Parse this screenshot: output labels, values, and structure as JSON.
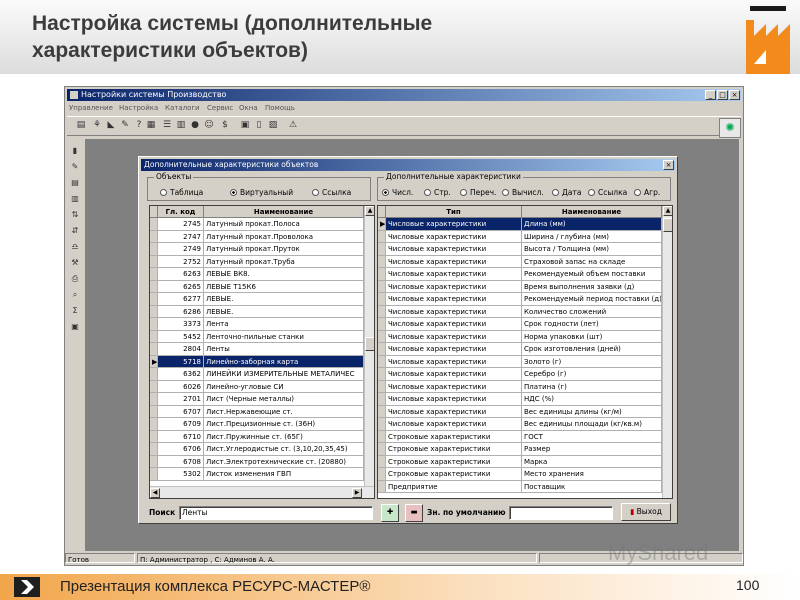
{
  "slide": {
    "title": "Настройка системы (дополнительные\nхарактеристики объектов)",
    "footer_text": "Презентация комплекса РЕСУРС-МАСТЕР®",
    "page_number": "100",
    "watermark": "MyShared"
  },
  "app": {
    "title": "Настройки системы Производство",
    "menu": [
      "Управление",
      "Настройка",
      "Каталоги",
      "Сервис",
      "Окна",
      "Помощь"
    ],
    "window_buttons": [
      "_",
      "□",
      "×"
    ],
    "status": {
      "ready": "Готов",
      "user": "П: Администратор , С: Админов А. А."
    }
  },
  "dialog": {
    "title": "Дополнительные характеристики объектов",
    "close": "×",
    "objects_group": {
      "caption": "Объекты",
      "options": [
        "Таблица",
        "Виртуальный",
        "Ссылка"
      ],
      "selected": "Виртуальный"
    },
    "chars_group": {
      "caption": "Дополнительные характеристики",
      "options": [
        "Числ.",
        "Стр.",
        "Переч.",
        "Вычисл.",
        "Дата",
        "Ссылка",
        "Агр."
      ],
      "selected": "Числ."
    },
    "left_table": {
      "columns": [
        "Гл. код",
        "Наименование"
      ],
      "selected_index": 11,
      "rows": [
        [
          "2745",
          "Латунный прокат.Полоса"
        ],
        [
          "2747",
          "Латунный прокат.Проволока"
        ],
        [
          "2749",
          "Латунный прокат.Пруток"
        ],
        [
          "2752",
          "Латунный прокат.Труба"
        ],
        [
          "6263",
          "ЛЕВЫЕ ВК8."
        ],
        [
          "6265",
          "ЛЕВЫЕ Т15К6"
        ],
        [
          "6277",
          "ЛЕВЫЕ."
        ],
        [
          "6286",
          "ЛЕВЫЕ."
        ],
        [
          "3373",
          "Лента"
        ],
        [
          "5452",
          "Ленточно-пильные станки"
        ],
        [
          "2804",
          "Ленты"
        ],
        [
          "5718",
          "Линейно-заборная карта"
        ],
        [
          "6362",
          "ЛИНЕЙКИ ИЗМЕРИТЕЛЬНЫЕ МЕТАЛИЧЕС"
        ],
        [
          "6026",
          "Линейно-угловые СИ"
        ],
        [
          "2701",
          "Лист (Черные металлы)"
        ],
        [
          "6707",
          "Лист.Нержавеющие ст."
        ],
        [
          "6709",
          "Лист.Прецизионные ст. (36Н)"
        ],
        [
          "6710",
          "Лист.Пружинные ст. (65Г)"
        ],
        [
          "6706",
          "Лист.Углеродистые ст. (3,10,20,35,45)"
        ],
        [
          "6708",
          "Лист.Электротехнические ст. (20880)"
        ],
        [
          "5302",
          "Листок изменения ГВП"
        ]
      ]
    },
    "right_table": {
      "columns": [
        "Тип",
        "Наименование"
      ],
      "rows": [
        [
          "Числовые характеристики",
          "Длина (мм)"
        ],
        [
          "Числовые характеристики",
          "Ширина / глубина (мм)"
        ],
        [
          "Числовые характеристики",
          "Высота / Толщина (мм)"
        ],
        [
          "Числовые характеристики",
          "Страховой запас на складе"
        ],
        [
          "Числовые характеристики",
          "Рекомендуемый объем поставки"
        ],
        [
          "Числовые характеристики",
          "Время выполнения заявки (д)"
        ],
        [
          "Числовые характеристики",
          "Рекомендуемый период поставки (д)"
        ],
        [
          "Числовые характеристики",
          "Количество сложений"
        ],
        [
          "Числовые характеристики",
          "Срок годности (лет)"
        ],
        [
          "Числовые характеристики",
          "Норма упаковки (шт)"
        ],
        [
          "Числовые характеристики",
          "Срок изготовления (дней)"
        ],
        [
          "Числовые характеристики",
          "Золото (г)"
        ],
        [
          "Числовые характеристики",
          "Серебро (г)"
        ],
        [
          "Числовые характеристики",
          "Платина (г)"
        ],
        [
          "Числовые характеристики",
          "НДС (%)"
        ],
        [
          "Числовые характеристики",
          "Вес единицы длины (кг/м)"
        ],
        [
          "Числовые характеристики",
          "Вес единицы площади (кг/кв.м)"
        ],
        [
          "Строковые характеристики",
          "ГОСТ"
        ],
        [
          "Строковые характеристики",
          "Размер"
        ],
        [
          "Строковые характеристики",
          "Марка"
        ],
        [
          "Строковые характеристики",
          "Место хранения"
        ],
        [
          "Предприятие",
          "Поставщик"
        ]
      ]
    },
    "search": {
      "label": "Поиск",
      "value": "Ленты"
    },
    "default_value": {
      "label": "Зн. по умолчанию",
      "value": ""
    },
    "exit_label": "Выход"
  }
}
